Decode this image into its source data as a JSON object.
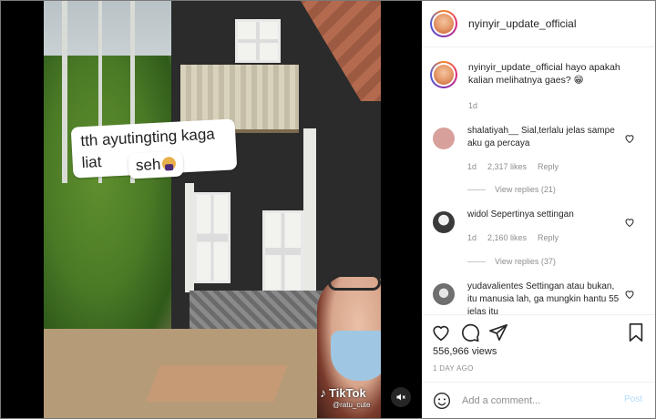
{
  "post": {
    "username": "nyinyir_update_official",
    "caption_username": "nyinyir_update_official",
    "caption_text": "hayo apakah kalian melihatnya gaes?",
    "caption_emoji": "😁",
    "caption_time": "1d"
  },
  "video": {
    "sticker_line1": "tth ayutingting kaga liat",
    "sticker_line2": "seh",
    "tiktok_logo": "TikTok",
    "tiktok_user": "@ratu_cute",
    "muted": true
  },
  "comments": [
    {
      "username": "shalatiyah__",
      "text": "Sial,terlalu jelas sampe aku ga percaya",
      "time": "1d",
      "likes": "2,317 likes",
      "reply_label": "Reply",
      "view_replies": "View replies (21)",
      "avatar_color": "#d8a09a"
    },
    {
      "username": "widol",
      "text": "Sepertinya settingan",
      "time": "1d",
      "likes": "2,160 likes",
      "reply_label": "Reply",
      "view_replies": "View replies (37)",
      "avatar_color": "#3a3a3a"
    },
    {
      "username": "yudavalientes",
      "text": "Settingan atau bukan, itu manusia lah, ga mungkin hantu 55 jelas itu",
      "time": "",
      "likes": "",
      "reply_label": "",
      "view_replies": "",
      "avatar_color": "#6f6f6f"
    }
  ],
  "actions": {
    "views": "556,966 views",
    "date": "1 DAY AGO"
  },
  "composer": {
    "placeholder": "Add a comment...",
    "post_label": "Post"
  },
  "colors": {
    "post_button_disabled": "#b3dbff",
    "secondary_text": "#8e8e8e",
    "primary_text": "#262626"
  }
}
